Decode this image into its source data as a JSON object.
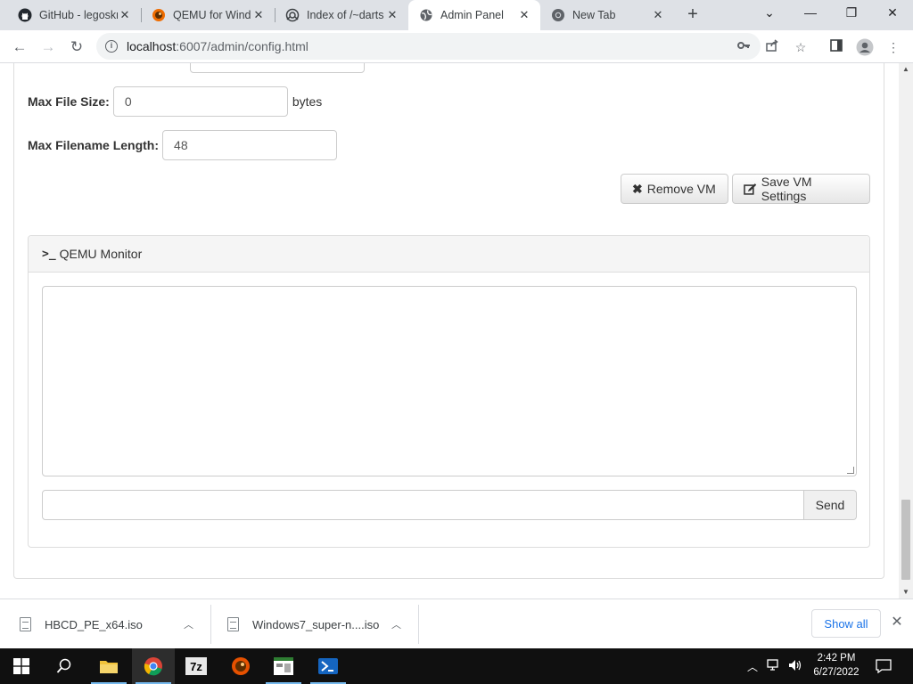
{
  "browser": {
    "tabs": [
      {
        "title": "GitHub - legoskr",
        "icon": "github-icon",
        "active": false
      },
      {
        "title": "QEMU for Windo",
        "icon": "qemu-icon",
        "active": false
      },
      {
        "title": "Index of /~darts",
        "icon": "index-icon",
        "active": false
      },
      {
        "title": "Admin Panel",
        "icon": "globe-icon",
        "active": true
      },
      {
        "title": "New Tab",
        "icon": "chrome-icon",
        "active": false
      }
    ],
    "url_host": "localhost",
    "url_path": ":6007/admin/config.html"
  },
  "form": {
    "max_file_size_label": "Max File Size:",
    "max_file_size_value": "0",
    "max_file_size_unit": "bytes",
    "max_filename_length_label": "Max Filename Length:",
    "max_filename_length_value": "48",
    "remove_vm_label": "Remove VM",
    "save_vm_label": "Save VM Settings"
  },
  "monitor": {
    "title": "QEMU Monitor",
    "send_label": "Send"
  },
  "downloads": {
    "items": [
      {
        "name": "HBCD_PE_x64.iso"
      },
      {
        "name": "Windows7_super-n....iso"
      }
    ],
    "show_all_label": "Show all"
  },
  "taskbar": {
    "time": "2:42 PM",
    "date": "6/27/2022"
  }
}
